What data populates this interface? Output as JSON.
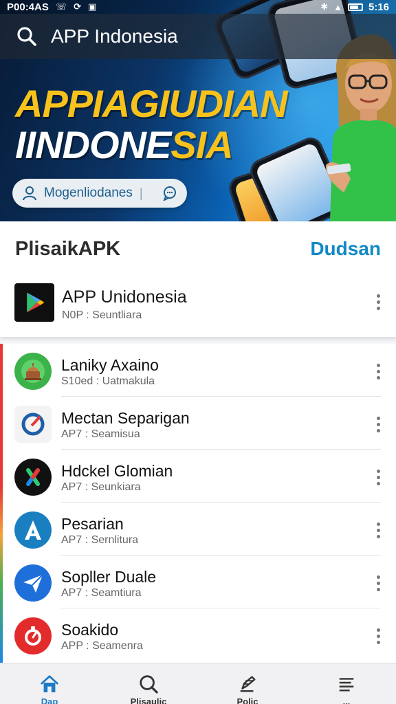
{
  "status_bar": {
    "left_text": "P00:4AS",
    "time": "5:16"
  },
  "search": {
    "query": "APP Indonesia"
  },
  "hero": {
    "title_line1": "APPIAGIUDIAN",
    "title_line2_main": "IINDONE",
    "title_line2_accent": "SIA",
    "pill_label": "Mogenliodanes",
    "pill_separator": "|"
  },
  "featured": {
    "section_title": "PlisaikAPK",
    "section_link": "Dudsan",
    "app": {
      "name": "APP Unidonesia",
      "subtitle": "N0P : Seuntliara",
      "icon": "play-store-icon"
    }
  },
  "apps": [
    {
      "name": "Laniky Axaino",
      "subtitle": "S10ed : Uatmakula",
      "icon": "monument-icon",
      "color": "#3bb24a"
    },
    {
      "name": "Mectan Separigan",
      "subtitle": "AP7 : Seamisua",
      "icon": "compass-icon",
      "color": "#f3f3f3"
    },
    {
      "name": "Hdckel Glomian",
      "subtitle": "AP7 : Seunkiara",
      "icon": "cross-icon",
      "color": "#111111"
    },
    {
      "name": "Pesarian",
      "subtitle": "AP7 : Sernlitura",
      "icon": "letter-a-icon",
      "color": "#1a7fc0"
    },
    {
      "name": "Sopller Duale",
      "subtitle": "AP7 : Seamtiura",
      "icon": "paper-plane-icon",
      "color": "#1e6fd9"
    },
    {
      "name": "Soakido",
      "subtitle": "APP : Seamenra",
      "icon": "timer-icon",
      "color": "#e42b2b"
    }
  ],
  "bottom_nav": [
    {
      "label": "Dap",
      "icon": "home-icon",
      "active": true
    },
    {
      "label": "Plisaulic",
      "icon": "search-icon",
      "active": false
    },
    {
      "label": "Polic",
      "icon": "edit-icon",
      "active": false
    },
    {
      "label": "...",
      "icon": "menu-icon",
      "active": false
    }
  ],
  "colors": {
    "accent": "#1189c7",
    "hero_yellow": "#f8c21c"
  }
}
